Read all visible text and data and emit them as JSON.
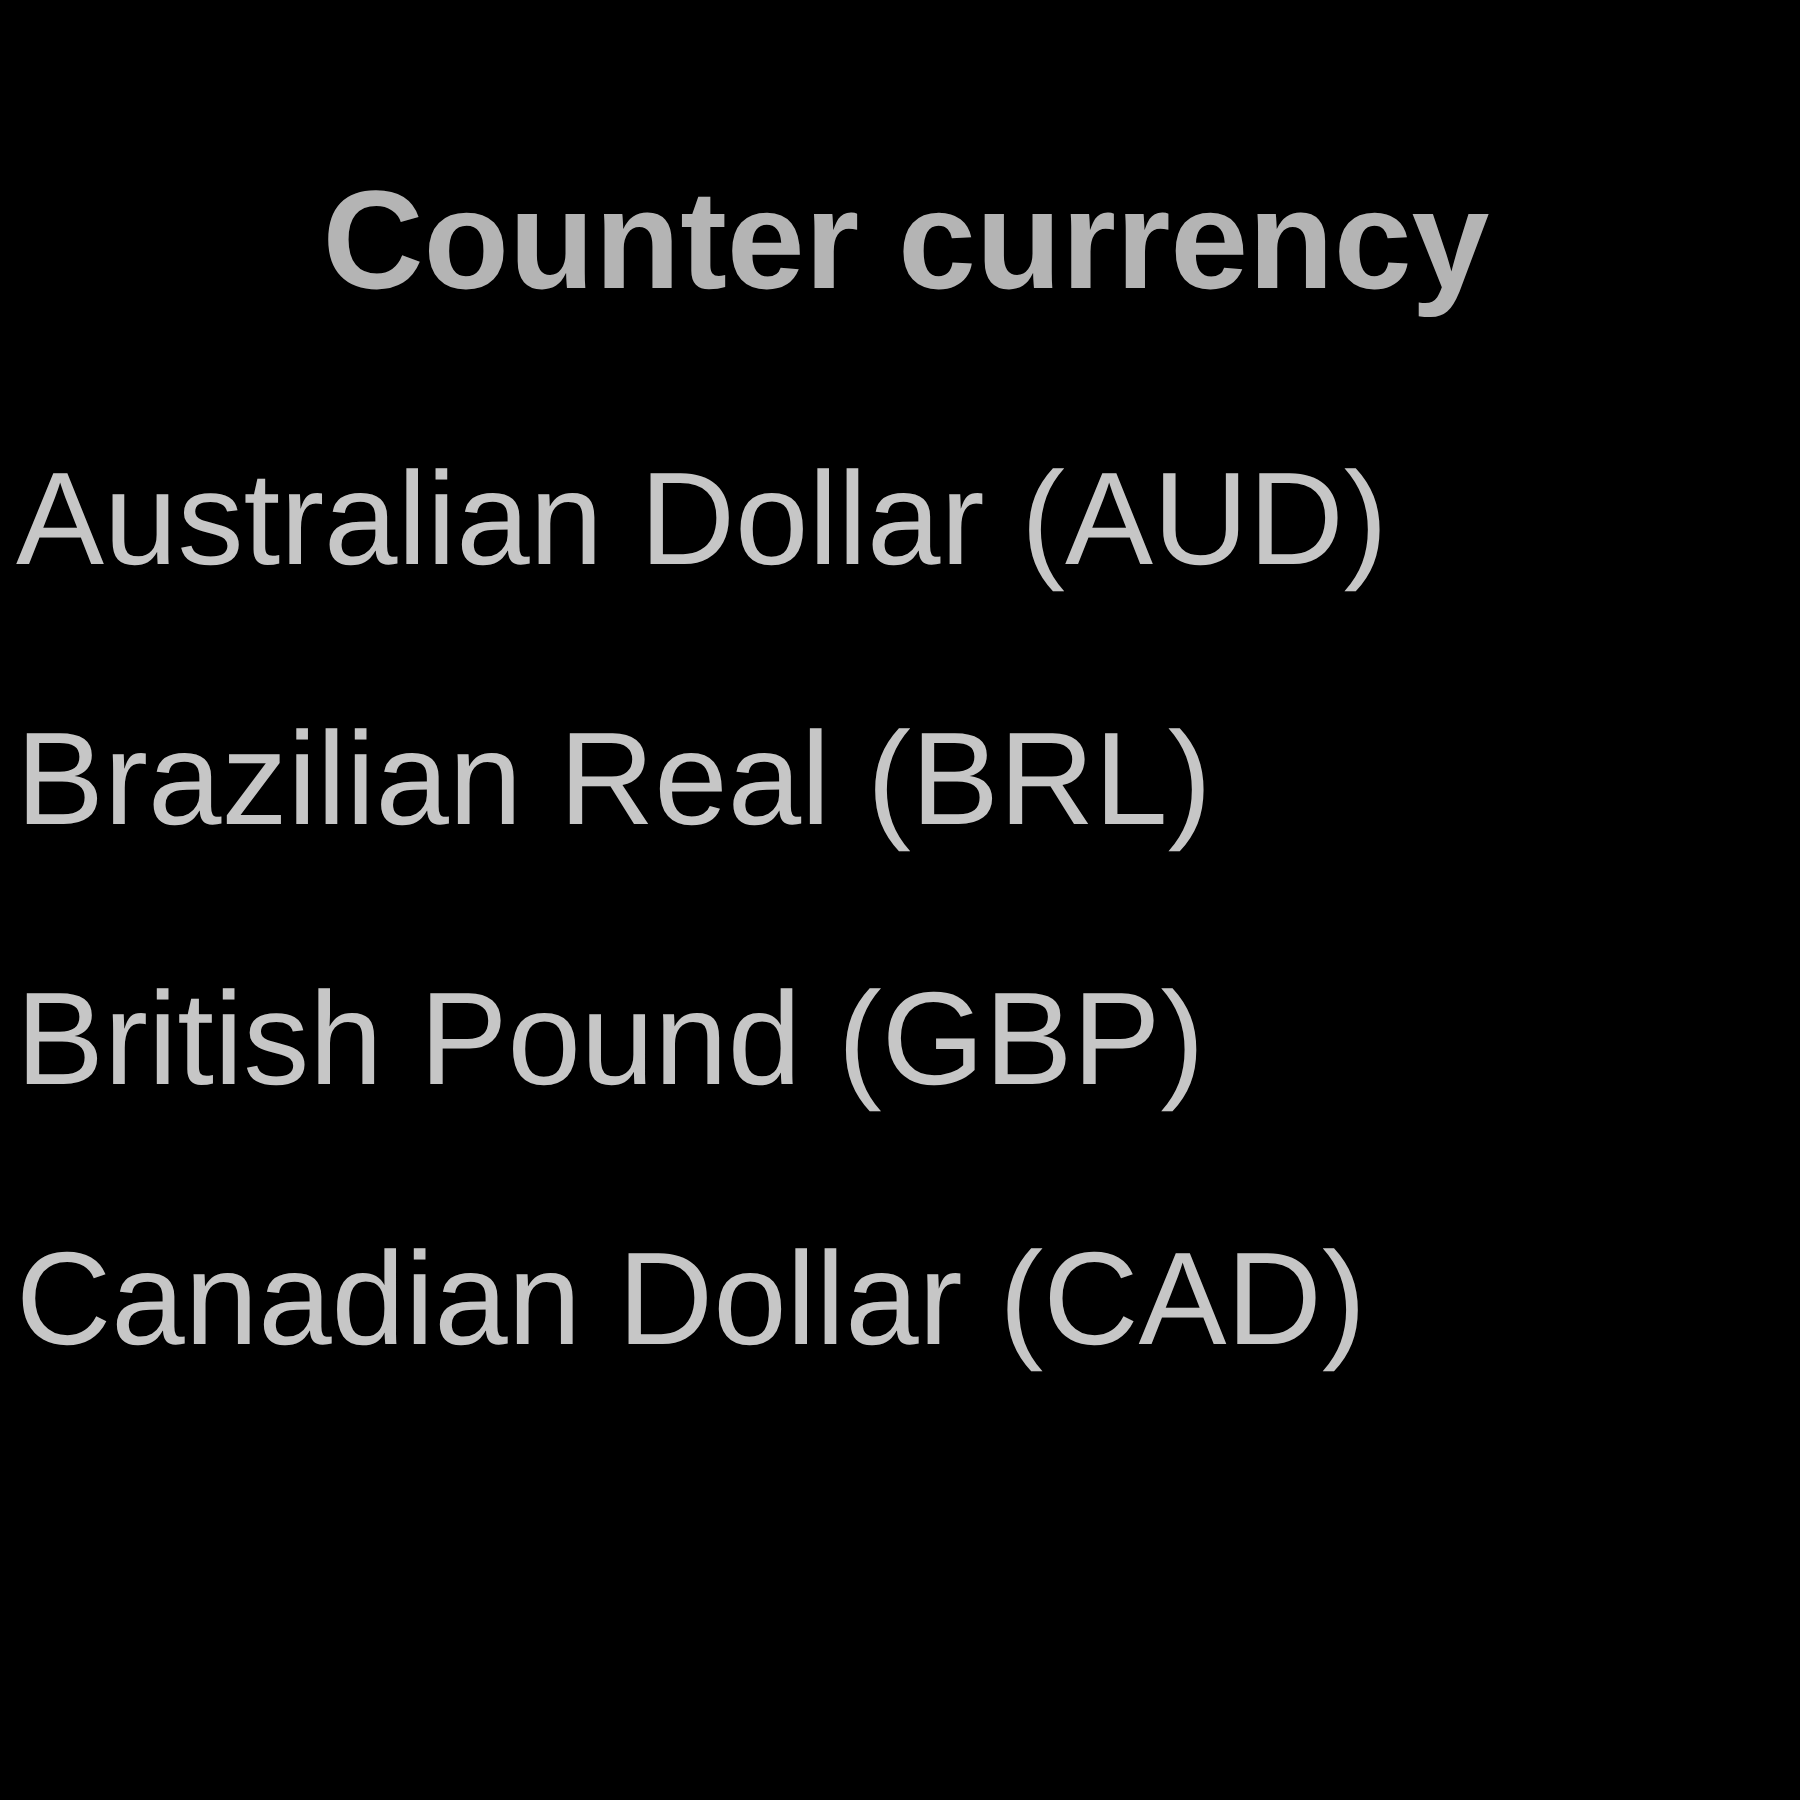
{
  "title": "Counter currency",
  "items": [
    {
      "label": "Australian Dollar (AUD)"
    },
    {
      "label": "Brazilian Real (BRL)"
    },
    {
      "label": "British Pound (GBP)"
    },
    {
      "label": "Canadian Dollar (CAD)"
    }
  ]
}
